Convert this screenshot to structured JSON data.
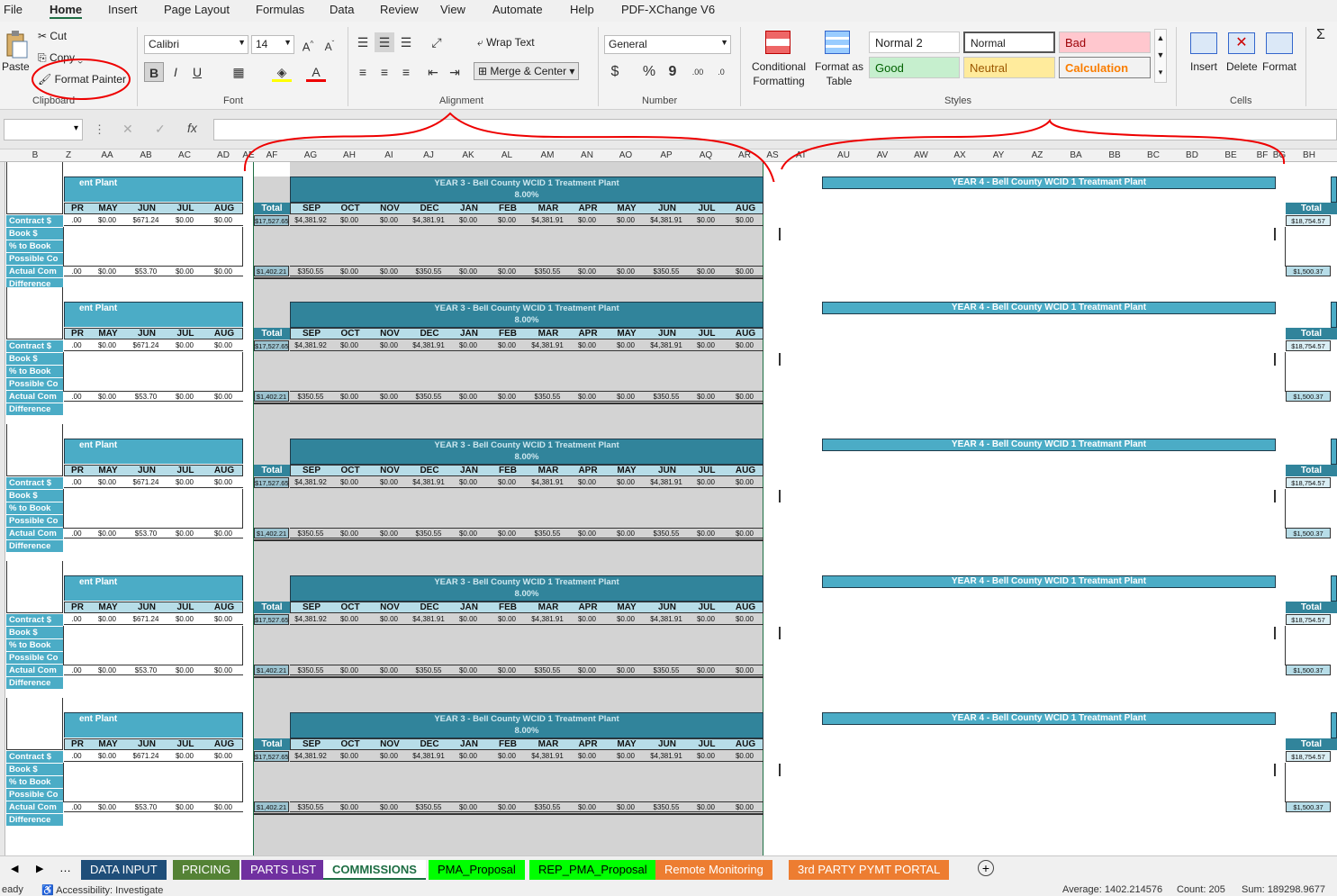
{
  "menu": [
    "File",
    "Home",
    "Insert",
    "Page Layout",
    "Formulas",
    "Data",
    "Review",
    "View",
    "Automate",
    "Help",
    "PDF-XChange V6"
  ],
  "clipboard": {
    "paste": "Paste",
    "cut": "Cut",
    "copy": "Copy",
    "format_painter": "Format Painter",
    "group": "Clipboard"
  },
  "font": {
    "name": "Calibri",
    "size": "14",
    "group": "Font",
    "bold": "B",
    "italic": "I",
    "underline": "U",
    "grow": "A^",
    "shrink": "Aˇ",
    "color_a": "A"
  },
  "alignment": {
    "wrap": "Wrap Text",
    "merge": "Merge & Center",
    "group": "Alignment"
  },
  "number": {
    "format": "General",
    "currency": "$",
    "percent": "%",
    "comma": "9",
    "inc_dec": ".00",
    "dec_dec": ".0",
    "group": "Number"
  },
  "styles": {
    "conditional": "Conditional Formatting",
    "format_table": "Format as Table",
    "group": "Styles",
    "boxes": [
      "Normal 2",
      "Normal",
      "Bad",
      "Good",
      "Neutral",
      "Calculation"
    ],
    "colors": {
      "bad_bg": "#ffc7ce",
      "bad_fg": "#9c0006",
      "good_bg": "#c6efce",
      "good_fg": "#006100",
      "neutral_bg": "#ffeb9c",
      "neutral_fg": "#9c5700",
      "calc_bg": "#f2f2f2",
      "calc_fg": "#fa7d00"
    }
  },
  "cells": {
    "insert": "Insert",
    "delete": "Delete",
    "format": "Format",
    "group": "Cells"
  },
  "formula": {
    "fx": "fx",
    "cancel": "✕",
    "enter": "✓"
  },
  "columns": [
    "B",
    "Z",
    "AA",
    "AB",
    "AC",
    "AD",
    "AE",
    "AF",
    "AG",
    "AH",
    "AI",
    "AJ",
    "AK",
    "AL",
    "AM",
    "AN",
    "AO",
    "AP",
    "AQ",
    "AR",
    "AS",
    "AT",
    "AU",
    "AV",
    "AW",
    "AX",
    "AY",
    "AZ",
    "BA",
    "BB",
    "BC",
    "BD",
    "BE",
    "BF",
    "BG",
    "BH"
  ],
  "row_labels": [
    "Contract $",
    "Book $",
    "% to Book",
    "Possible Co",
    "Actual Com",
    "Difference"
  ],
  "left_months": [
    "PR",
    "MAY",
    "JUN",
    "JUL",
    "AUG"
  ],
  "left_title": "ent Plant",
  "left_contract_vals": [
    ".00",
    "$0.00",
    "$671.24",
    "$0.00",
    "$0.00"
  ],
  "left_actual_vals": [
    ".00",
    "$0.00",
    "$53.70",
    "$0.00",
    "$0.00"
  ],
  "y3_title": "YEAR 3 - Bell County WCID 1 Treatment Plant",
  "y3_rate": "8.00%",
  "y3_total_label": "Total",
  "y3_months": [
    "SEP",
    "OCT",
    "NOV",
    "DEC",
    "JAN",
    "FEB",
    "MAR",
    "APR",
    "MAY",
    "JUN",
    "JUL",
    "AUG"
  ],
  "y3_contract_total": "$17,527.65",
  "y3_contract_vals": [
    "$4,381.92",
    "$0.00",
    "$0.00",
    "$4,381.91",
    "$0.00",
    "$0.00",
    "$4,381.91",
    "$0.00",
    "$0.00",
    "$4,381.91",
    "$0.00",
    "$0.00"
  ],
  "y3_actual_total": "$1,402.21",
  "y3_actual_vals": [
    "$350.55",
    "$0.00",
    "$0.00",
    "$350.55",
    "$0.00",
    "$0.00",
    "$350.55",
    "$0.00",
    "$0.00",
    "$350.55",
    "$0.00",
    "$0.00"
  ],
  "y4_title": "YEAR 4 - Bell County WCID 1 Treatmant Plant",
  "y4_total_label": "Total",
  "y4_contract_total": "$18,754.57",
  "y4_actual_total": "$1,500.37",
  "tabs": [
    {
      "label": "DATA INPUT",
      "bg": "#1f4e79",
      "fg": "#ffffff"
    },
    {
      "label": "PRICING",
      "bg": "#548235",
      "fg": "#ffffff"
    },
    {
      "label": "PARTS LIST",
      "bg": "#7030a0",
      "fg": "#ffffff"
    },
    {
      "label": "COMMISSIONS",
      "bg": "#ffffff",
      "fg": "#1e6e44"
    },
    {
      "label": "PMA_Proposal",
      "bg": "#00ff00",
      "fg": "#000000"
    },
    {
      "label": "REP_PMA_Proposal",
      "bg": "#00ff00",
      "fg": "#000000"
    },
    {
      "label": "Remote Monitoring",
      "bg": "#ed7d31",
      "fg": "#ffffff"
    },
    {
      "label": "3rd PARTY PYMT PORTAL",
      "bg": "#ed7d31",
      "fg": "#ffffff"
    }
  ],
  "status": {
    "ready": "eady",
    "accessibility": "Accessibility: Investigate",
    "average": "Average: 1402.214576",
    "count": "Count: 205",
    "sum": "Sum: 189298.9677"
  }
}
